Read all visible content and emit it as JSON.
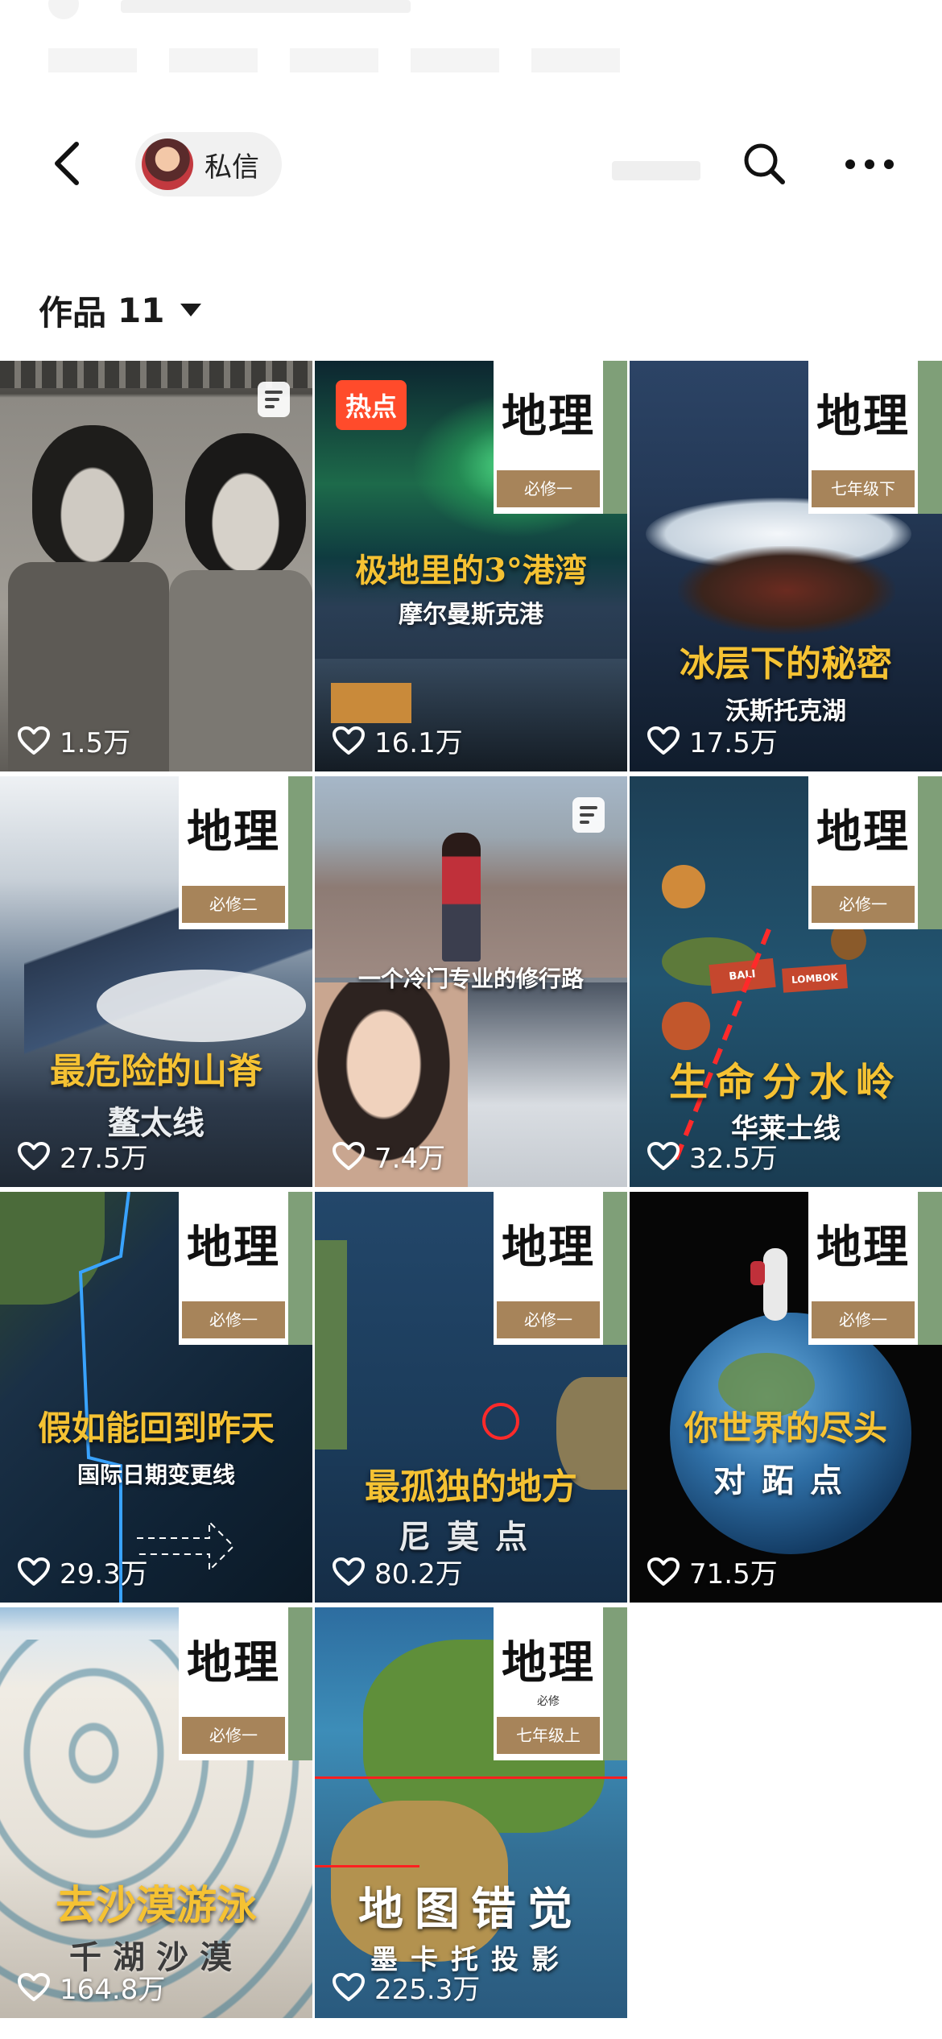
{
  "header": {
    "chat_label": "私信"
  },
  "works": {
    "label": "作品",
    "count": "11"
  },
  "videos": [
    {
      "likes": "1.5万"
    },
    {
      "badge": "热点",
      "caption": "极地里的3°港湾",
      "subcaption": "摩尔曼斯克港",
      "tag_title": "地理",
      "tag": "必修一",
      "likes": "16.1万"
    },
    {
      "caption": "冰层下的秘密",
      "subcaption": "沃斯托克湖",
      "tag_title": "地理",
      "tag": "七年级下",
      "likes": "17.5万"
    },
    {
      "caption": "最危险的山脊",
      "subcaption": "鳌太线",
      "tag_title": "地理",
      "tag": "必修二",
      "likes": "27.5万"
    },
    {
      "caption": "一个冷门专业的修行路",
      "likes": "7.4万"
    },
    {
      "caption": "生命分水岭",
      "subcaption": "华莱士线",
      "tag_title": "地理",
      "tag": "必修一",
      "likes": "32.5万",
      "map_labels": [
        "BALI",
        "LOMBOK"
      ]
    },
    {
      "caption": "假如能回到昨天",
      "subcaption": "国际日期变更线",
      "tag_title": "地理",
      "tag": "必修一",
      "likes": "29.3万"
    },
    {
      "caption": "最孤独的地方",
      "subcaption": "尼莫点",
      "tag_title": "地理",
      "tag": "必修一",
      "likes": "80.2万"
    },
    {
      "caption": "你世界的尽头",
      "subcaption": "对跖点",
      "tag_title": "地理",
      "tag": "必修一",
      "likes": "71.5万"
    },
    {
      "caption": "去沙漠游泳",
      "subcaption": "千湖沙漠",
      "tag_title": "地理",
      "tag": "必修一",
      "likes": "164.8万"
    },
    {
      "caption": "地图错觉",
      "subcaption": "墨卡托投影",
      "tag_title": "地理",
      "tag_sub": "必修",
      "tag": "七年级上",
      "likes": "225.3万"
    }
  ],
  "colors": {
    "caption_yellow": "#f5c233",
    "hot_badge": "#ff4b2b",
    "tag_brown": "#a7845a",
    "tag_green": "#7f9f78"
  }
}
